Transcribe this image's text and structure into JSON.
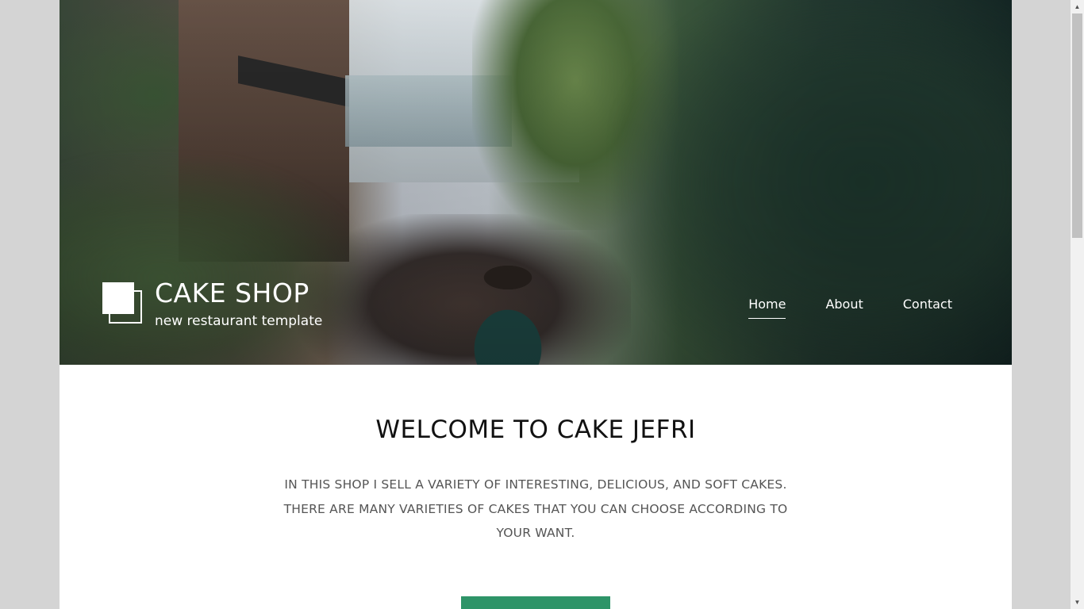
{
  "brand": {
    "title": "CAKE SHOP",
    "subtitle": "new restaurant template"
  },
  "nav": {
    "items": [
      {
        "label": "Home",
        "active": true
      },
      {
        "label": "About",
        "active": false
      },
      {
        "label": "Contact",
        "active": false
      }
    ]
  },
  "welcome": {
    "title": "WELCOME TO CAKE JEFRI",
    "text": "IN THIS SHOP I SELL A VARIETY OF INTERESTING, DELICIOUS, AND SOFT CAKES. THERE ARE MANY VARIETIES OF CAKES THAT YOU CAN CHOOSE ACCORDING TO YOUR WANT."
  },
  "colors": {
    "accent": "#2e9468",
    "page_bg": "#d4d4d4"
  }
}
